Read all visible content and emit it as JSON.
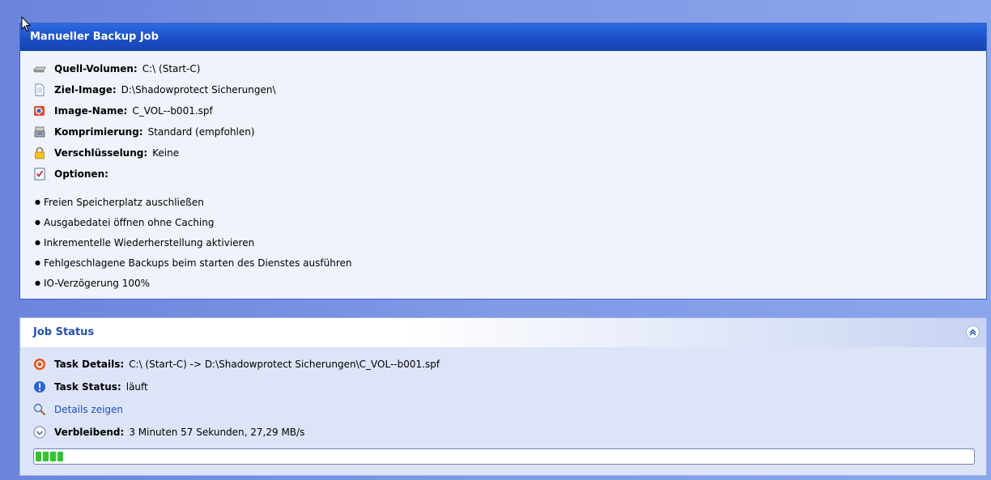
{
  "backup_panel": {
    "title": "Manueller Backup Job",
    "source": {
      "label": "Quell-Volumen:",
      "value": "C:\\ (Start-C)",
      "icon": "drive-icon"
    },
    "target": {
      "label": "Ziel-Image:",
      "value": "D:\\Shadowprotect Sicherungen\\",
      "icon": "document-icon"
    },
    "image_name": {
      "label": "Image-Name:",
      "value": "C_VOL--b001.spf",
      "icon": "image-file-icon"
    },
    "compression": {
      "label": "Komprimierung:",
      "value": "Standard (empfohlen)",
      "icon": "compress-icon"
    },
    "encryption": {
      "label": "Verschlüsselung:",
      "value": "Keine",
      "icon": "lock-icon"
    },
    "options": {
      "label": "Optionen:",
      "icon": "checklist-icon",
      "items": [
        "Freien Speicherplatz auschließen",
        "Ausgabedatei öffnen ohne Caching",
        "Inkrementelle Wiederherstellung aktivieren",
        "Fehlgeschlagene Backups beim starten des Dienstes ausführen",
        "IO-Verzögerung 100%"
      ]
    }
  },
  "status_panel": {
    "title": "Job Status",
    "task_details": {
      "label": "Task Details:",
      "value": "C:\\ (Start-C) -> D:\\Shadowprotect Sicherungen\\C_VOL--b001.spf",
      "icon": "target-icon"
    },
    "task_status": {
      "label": "Task Status:",
      "value": "läuft",
      "icon": "info-icon"
    },
    "details_link": {
      "label": "Details zeigen",
      "icon": "magnifier-icon"
    },
    "remaining": {
      "label": "Verbleibend:",
      "value": "3 Minuten 57 Sekunden, 27,29 MB/s",
      "icon": "clock-icon"
    },
    "progress_percent": 3
  },
  "colors": {
    "title_bar": "#1b4fc8",
    "status_title": "#2150b8",
    "progress_fill": "#2ec82e",
    "link": "#1a4ec0"
  }
}
